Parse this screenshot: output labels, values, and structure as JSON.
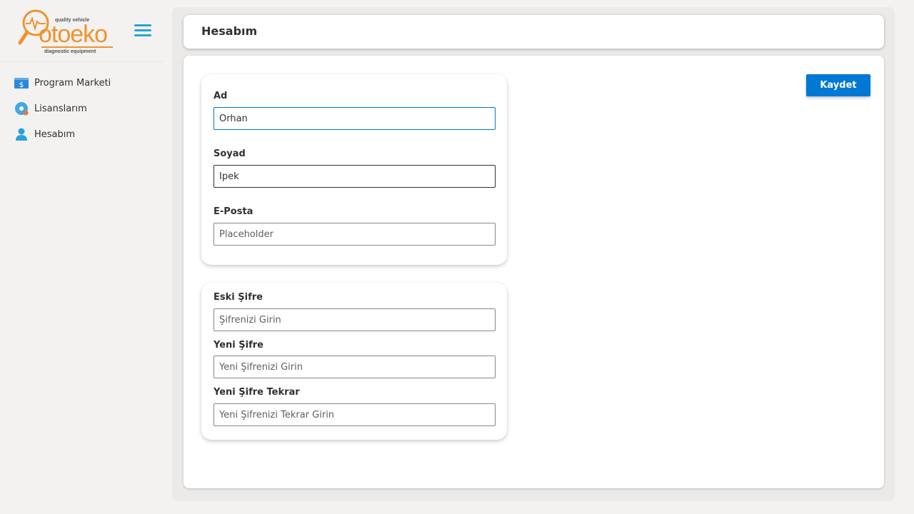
{
  "logo": {
    "tagline": "quality vehicle",
    "brand": "otoeko",
    "sub": "diagnostic equipment"
  },
  "sidebar": {
    "items": [
      {
        "label": "Program Marketi",
        "icon": "store-icon"
      },
      {
        "label": "Lisanslarım",
        "icon": "license-disc-icon"
      },
      {
        "label": "Hesabım",
        "icon": "user-icon"
      }
    ]
  },
  "header": {
    "title": "Hesabım"
  },
  "toolbar": {
    "save_label": "Kaydet"
  },
  "profile": {
    "first_name": {
      "label": "Ad",
      "value": "Orhan"
    },
    "last_name": {
      "label": "Soyad",
      "value": "İpek"
    },
    "email": {
      "label": "E-Posta",
      "placeholder": "Placeholder"
    }
  },
  "password": {
    "old": {
      "label": "Eski Şifre",
      "placeholder": "Şifrenizi Girin"
    },
    "new": {
      "label": "Yeni Şifre",
      "placeholder": "Yeni Şifrenizi Girin"
    },
    "confirm": {
      "label": "Yeni Şifre Tekrar",
      "placeholder": "Yeni Şifrenizi Tekrar Girin"
    }
  },
  "colors": {
    "accent": "#0078d4",
    "brand": "#f0932b",
    "menu_icon": "#2aa3d9"
  }
}
